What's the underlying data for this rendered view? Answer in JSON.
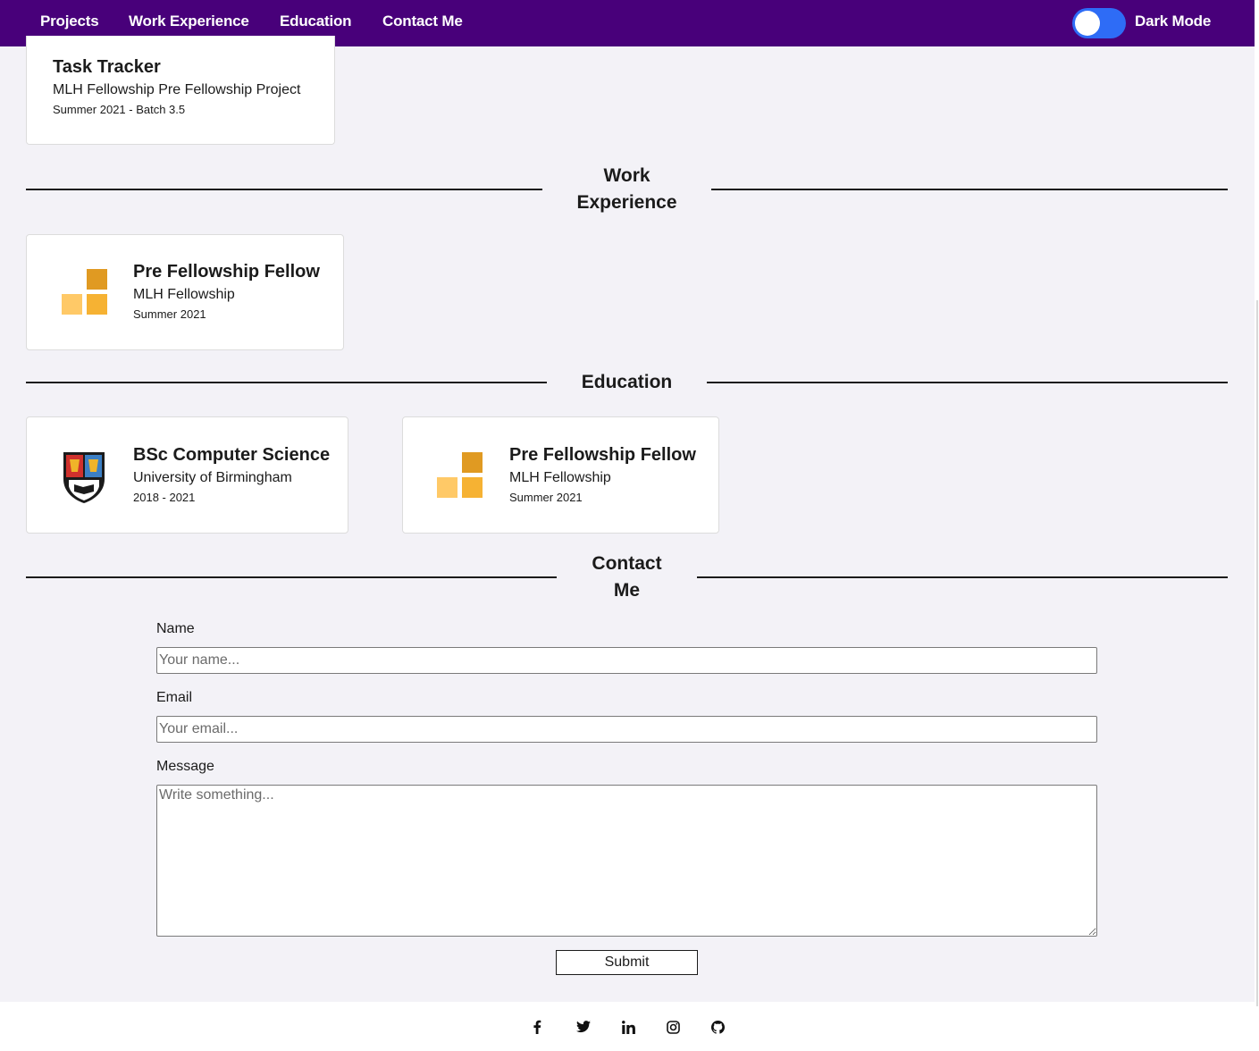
{
  "nav": {
    "links": [
      "Projects",
      "Work Experience",
      "Education",
      "Contact Me"
    ],
    "dark_mode_label": "Dark Mode"
  },
  "projects": [
    {
      "title": "Task Tracker",
      "subtitle": "MLH Fellowship Pre Fellowship Project",
      "date": "Summer 2021 - Batch 3.5"
    }
  ],
  "work_section": {
    "title_line1": "Work",
    "title_line2": "Experience"
  },
  "work": [
    {
      "title": "Pre Fellowship Fellow",
      "subtitle": "MLH Fellowship",
      "date": "Summer 2021",
      "icon": "mlh-logo-icon"
    }
  ],
  "education_section": {
    "title": "Education"
  },
  "education": [
    {
      "title": "BSc Computer Science",
      "subtitle": "University of Birmingham",
      "date": "2018 - 2021",
      "icon": "uob-crest-icon"
    },
    {
      "title": "Pre Fellowship Fellow",
      "subtitle": "MLH Fellowship",
      "date": "Summer 2021",
      "icon": "mlh-logo-icon"
    }
  ],
  "contact_section": {
    "title_line1": "Contact",
    "title_line2": "Me"
  },
  "form": {
    "name_label": "Name",
    "name_placeholder": "Your name...",
    "email_label": "Email",
    "email_placeholder": "Your email...",
    "message_label": "Message",
    "message_placeholder": "Write something...",
    "submit_label": "Submit"
  },
  "footer": {
    "social_icons": [
      "facebook-icon",
      "twitter-icon",
      "linkedin-icon",
      "instagram-icon",
      "github-icon"
    ]
  },
  "colors": {
    "nav_bg": "#48007a",
    "toggle": "#2e6cf6",
    "page_bg": "#f3f2f7",
    "mlh_orange_dark": "#e09a22",
    "mlh_orange": "#f6b233",
    "mlh_orange_light": "#ffc967"
  }
}
